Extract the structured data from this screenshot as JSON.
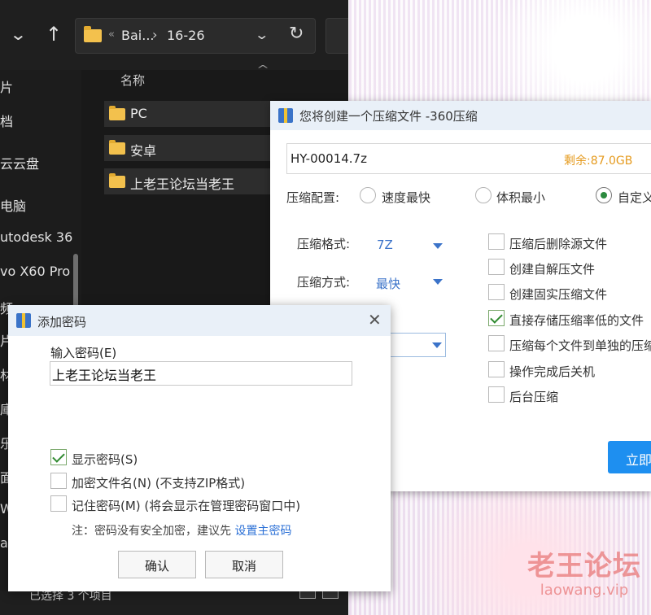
{
  "explorer": {
    "breadcrumb": [
      "Bai...",
      "16-26"
    ],
    "column_header": "名称",
    "nav_items": [
      "片",
      "档",
      "云云盘",
      "电脑",
      "utodesk 36",
      "vo X60 Pro",
      "频",
      "片",
      "材",
      "庫",
      "乐",
      "面",
      "Wi",
      "at"
    ],
    "files": [
      "PC",
      "安卓",
      "上老王论坛当老王"
    ],
    "status": "已选择 3 个项目"
  },
  "zip_dialog": {
    "title": "您将创建一个压缩文件 -360压缩",
    "filename": "HY-00014.7z",
    "free_space": "剩余:87.0GB",
    "config_label": "压缩配置:",
    "config_options": [
      "速度最快",
      "体积最小",
      "自定义"
    ],
    "config_selected": 2,
    "format_label": "压缩格式:",
    "format_value": "7Z",
    "method_label": "压缩方式:",
    "method_value": "最快",
    "options": [
      {
        "label": "压缩后删除源文件",
        "checked": false
      },
      {
        "label": "创建自解压文件",
        "checked": false
      },
      {
        "label": "创建固实压缩文件",
        "checked": false
      },
      {
        "label": "直接存储压缩率低的文件",
        "checked": true
      },
      {
        "label": "压缩每个文件到单独的压缩",
        "checked": false
      },
      {
        "label": "操作完成后关机",
        "checked": false
      },
      {
        "label": "后台压缩",
        "checked": false
      }
    ],
    "start_button": "立即"
  },
  "password_dialog": {
    "title": "添加密码",
    "input_label": "输入密码(E)",
    "password_value": "上老王论坛当老王",
    "checkboxes": [
      {
        "label": "显示密码(S)",
        "checked": true
      },
      {
        "label": "加密文件名(N) (不支持ZIP格式)",
        "checked": false
      },
      {
        "label": "记住密码(M) (将会显示在管理密码窗口中)",
        "checked": false
      }
    ],
    "note_prefix": "注：密码没有安全加密，建议先",
    "note_link": "设置主密码",
    "ok_button": "确认",
    "cancel_button": "取消"
  },
  "watermark": {
    "cn": "老王论坛",
    "en": "laowang.vip"
  },
  "colors": {
    "accent": "#1e8ff0",
    "free_space": "#e59a1d",
    "link": "#2a6fd6",
    "explorer_bg": "#1c1c1c"
  }
}
